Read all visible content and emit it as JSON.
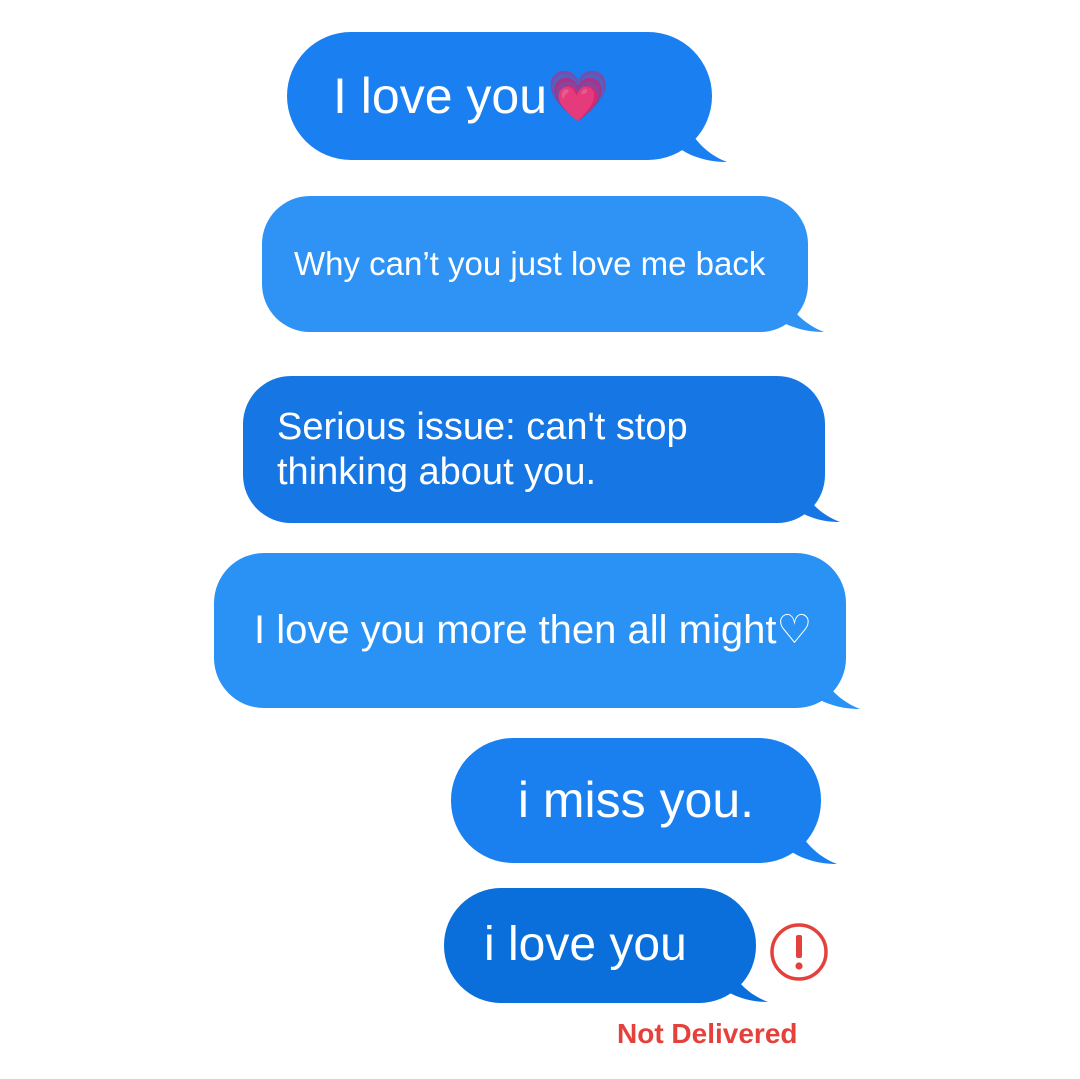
{
  "messages": [
    {
      "text": "I love you",
      "emoji": "💗",
      "color": "#1a7ff0"
    },
    {
      "text": "Why can’t you just love me back",
      "color": "#2f93f6"
    },
    {
      "text": "Serious issue: can't stop thinking about you.",
      "color": "#1677e4"
    },
    {
      "text": "I love you more then all might♡",
      "color": "#2b92f5"
    },
    {
      "text": "i miss you.",
      "color": "#1a80f0"
    },
    {
      "text": "i love you",
      "color": "#0b6fdb"
    }
  ],
  "status": {
    "label": "Not Delivered",
    "icon": "exclamation-circle-icon",
    "color": "#e5413c"
  }
}
